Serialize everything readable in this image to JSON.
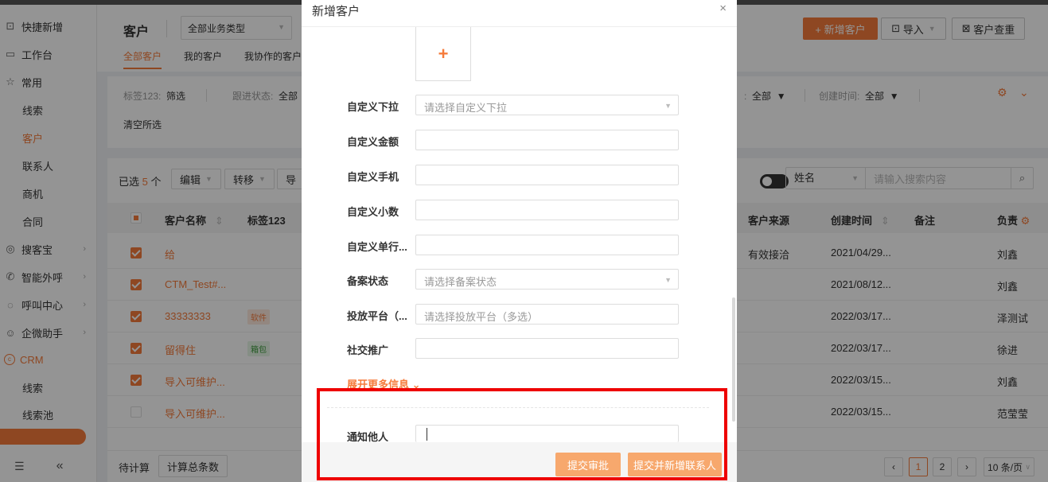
{
  "sidebar": {
    "items": [
      {
        "label": "快捷新增",
        "icon": "quick-add-icon"
      },
      {
        "label": "工作台",
        "icon": "desktop-icon"
      },
      {
        "label": "常用",
        "icon": "star-icon"
      },
      {
        "label": "线索"
      },
      {
        "label": "客户"
      },
      {
        "label": "联系人"
      },
      {
        "label": "商机"
      },
      {
        "label": "合同"
      },
      {
        "label": "搜客宝",
        "icon": "search-treasure-icon"
      },
      {
        "label": "智能外呼",
        "icon": "phone-icon"
      },
      {
        "label": "呼叫中心",
        "icon": "call-center-icon"
      },
      {
        "label": "企微助手",
        "icon": "wecom-icon"
      },
      {
        "label": "CRM",
        "icon": "crm-icon"
      },
      {
        "label": "线索"
      },
      {
        "label": "线索池"
      }
    ],
    "bottom": {
      "menu_icon": "menu-list-icon",
      "collapse_glyph": "«"
    }
  },
  "header": {
    "title": "客户",
    "type_select": "全部业务类型",
    "tabs": [
      "全部客户",
      "我的客户",
      "我协作的客户"
    ],
    "new_button": "+ 新增客户",
    "import_button": "导入",
    "check_button": "客户查重"
  },
  "filters": {
    "tag_label": "标签123:",
    "tag_value": "筛选",
    "follow_label": "跟进状态:",
    "follow_value": "全部",
    "hidden_value": "全部",
    "created_label": "创建时间:",
    "created_value": "全部",
    "clear": "清空所选"
  },
  "toolbar": {
    "selected_prefix": "已选",
    "selected_count": "5",
    "selected_suffix": "个",
    "edit": "编辑",
    "transfer": "转移",
    "export_partial": "导",
    "search_field": "姓名",
    "search_placeholder": "请输入搜索内容"
  },
  "table": {
    "columns": [
      "客户名称",
      "标签123",
      "客户来源",
      "创建时间",
      "备注",
      "负责"
    ],
    "rows": [
      {
        "checked": true,
        "name": "给",
        "tag": "",
        "source": "有效接洽",
        "created": "2021/04/29...",
        "owner": "刘鑫"
      },
      {
        "checked": true,
        "name": "CTM_Test#...",
        "tag": "",
        "source": "",
        "created": "2021/08/12...",
        "owner": "刘鑫"
      },
      {
        "checked": true,
        "name": "33333333",
        "tag": "软件",
        "source": "",
        "created": "2022/03/17...",
        "owner": "泽测试"
      },
      {
        "checked": true,
        "name": "留得住",
        "tag": "箱包",
        "source": "",
        "created": "2022/03/17...",
        "owner": "徐进"
      },
      {
        "checked": true,
        "name": "导入可维护...",
        "tag": "",
        "source": "",
        "created": "2022/03/15...",
        "owner": "刘鑫"
      },
      {
        "checked": false,
        "name": "导入可维护...",
        "tag": "",
        "source": "",
        "created": "2022/03/15...",
        "owner": "范莹莹"
      }
    ]
  },
  "footer": {
    "pending": "待计算",
    "count_button": "计算总条数",
    "page_current": "1",
    "page_next": "2",
    "page_size": "10 条/页"
  },
  "modal": {
    "title": "新增客户",
    "close": "×",
    "upload_glyph": "+",
    "fields": [
      {
        "label": "自定义下拉",
        "placeholder": "请选择自定义下拉",
        "dropdown": true
      },
      {
        "label": "自定义金额",
        "placeholder": ""
      },
      {
        "label": "自定义手机",
        "placeholder": ""
      },
      {
        "label": "自定义小数",
        "placeholder": ""
      },
      {
        "label": "自定义单行...",
        "placeholder": ""
      },
      {
        "label": "备案状态",
        "placeholder": "请选择备案状态",
        "dropdown": true
      },
      {
        "label": "投放平台（...",
        "placeholder": "请选择投放平台（多选）"
      },
      {
        "label": "社交推广",
        "placeholder": ""
      }
    ],
    "expand": "展开更多信息",
    "notify_label": "通知他人",
    "submit": "提交审批",
    "submit_contact": "提交并新增联系人"
  },
  "colors": {
    "accent": "#f57b3b",
    "highlight": "#e00000"
  }
}
